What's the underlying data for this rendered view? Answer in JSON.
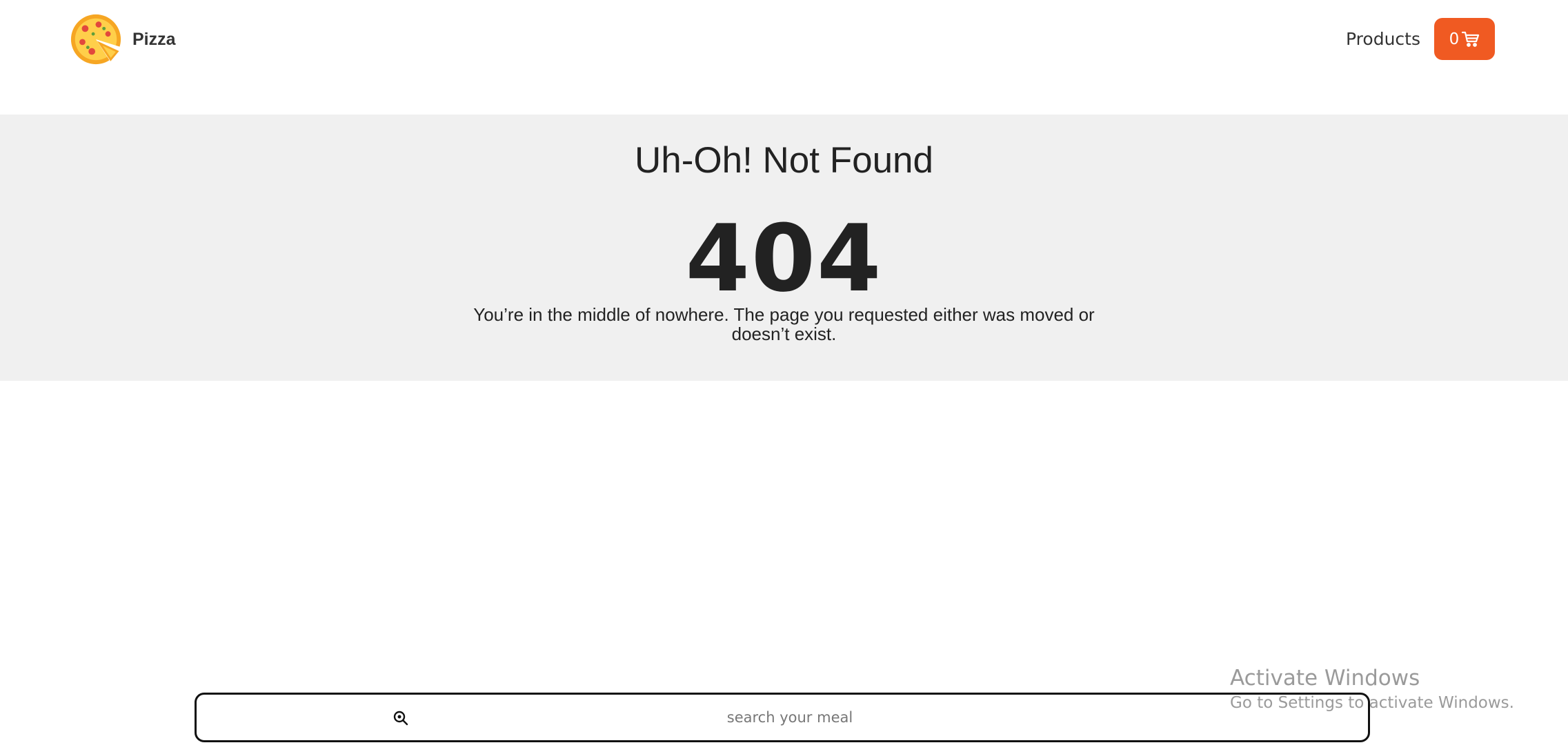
{
  "header": {
    "brand_name": "Pizza",
    "logo_icon": "pizza-icon",
    "nav": {
      "products_label": "Products",
      "cart_count": "0",
      "cart_icon": "cart-icon"
    }
  },
  "not_found": {
    "title": "Uh-Oh! Not Found",
    "code": "404",
    "message": "You’re in the middle of nowhere. The page you requested either was moved or doesn’t exist."
  },
  "search": {
    "icon": "search-icon",
    "placeholder": "search your meal",
    "value": ""
  },
  "watermark": {
    "title": "Activate Windows",
    "subtitle": "Go to Settings to activate Windows."
  },
  "colors": {
    "accent": "#f05a22",
    "panel_background": "#f0f0f0",
    "text": "#222222"
  }
}
